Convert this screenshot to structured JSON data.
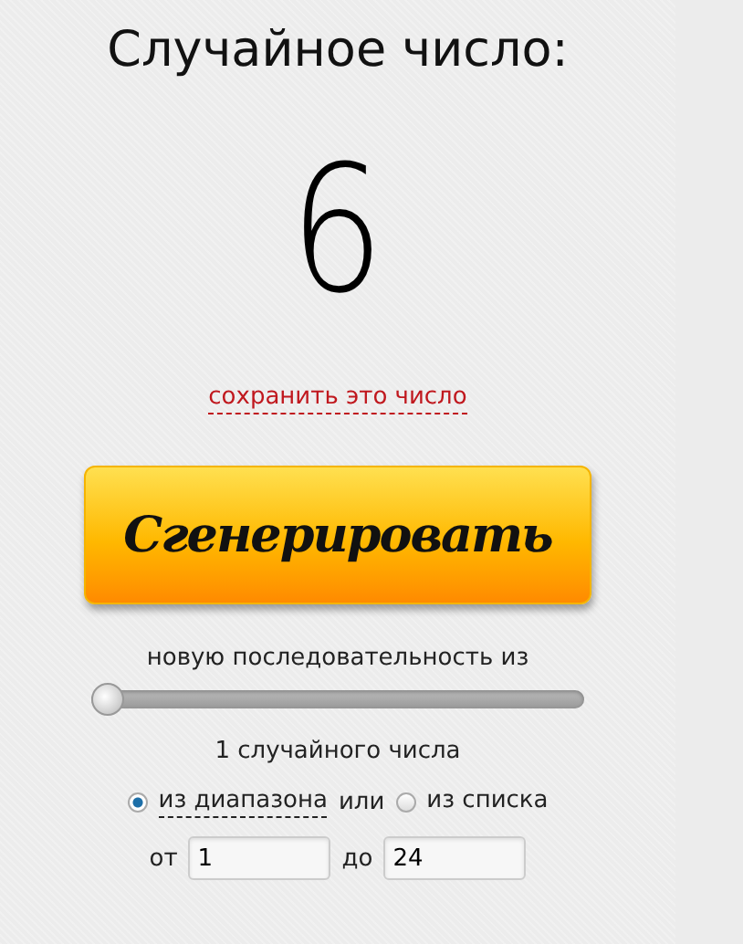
{
  "title": "Случайное число:",
  "result": "6",
  "save_link": "сохранить это число",
  "generate_button": "Сгенерировать",
  "sequence_label": "новую последовательность из",
  "count_slider": {
    "level": 0
  },
  "count_label": "1 случайного числа",
  "source_options": [
    {
      "label": "из диапазона",
      "selected": true,
      "dashed": true
    },
    {
      "label": "из списка",
      "selected": false,
      "dashed": false
    }
  ],
  "source_separator": "или",
  "range": {
    "from_label": "от",
    "from_value": "1",
    "to_label": "до",
    "to_value": "24"
  }
}
